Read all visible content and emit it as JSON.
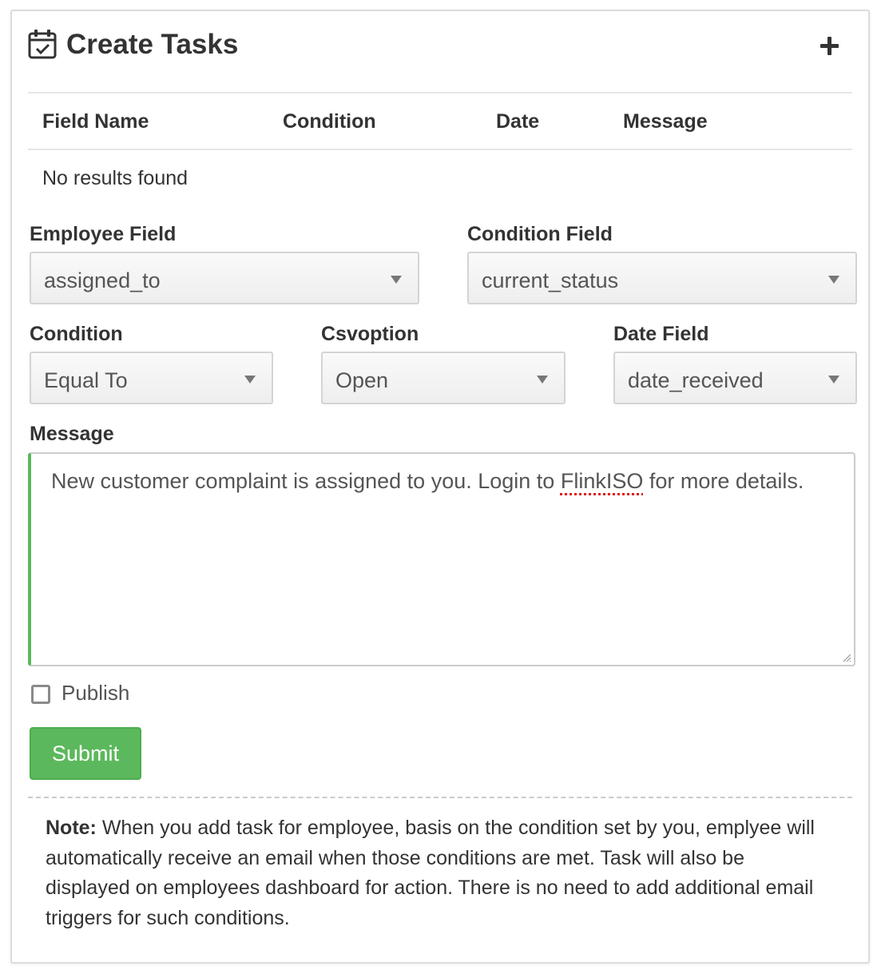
{
  "header": {
    "title": "Create Tasks",
    "icon": "calendar-check-icon",
    "add_icon": "plus-icon"
  },
  "table": {
    "columns": [
      "Field Name",
      "Condition",
      "Date",
      "Message"
    ],
    "empty_text": "No results found"
  },
  "form": {
    "employee_field": {
      "label": "Employee Field",
      "value": "assigned_to"
    },
    "condition_field": {
      "label": "Condition Field",
      "value": "current_status"
    },
    "condition": {
      "label": "Condition",
      "value": "Equal To"
    },
    "csvoption": {
      "label": "Csvoption",
      "value": "Open"
    },
    "date_field": {
      "label": "Date Field",
      "value": "date_received"
    },
    "message": {
      "label": "Message",
      "text_before": "New customer complaint is assigned to you. Login to ",
      "text_flagged": "FlinkISO",
      "text_after": " for more details."
    },
    "publish": {
      "label": "Publish",
      "checked": false
    },
    "submit_label": "Submit"
  },
  "note": {
    "prefix": "Note:",
    "text": " When you add task for employee, basis on the condition set by you, emplyee will automatically receive an email when those conditions are met. Task will also be displayed on employees dashboard for action. There is no need to add additional email triggers for such conditions."
  },
  "colors": {
    "accent_green": "#5cb85c",
    "text": "#333333",
    "border": "#d4d4d4"
  }
}
